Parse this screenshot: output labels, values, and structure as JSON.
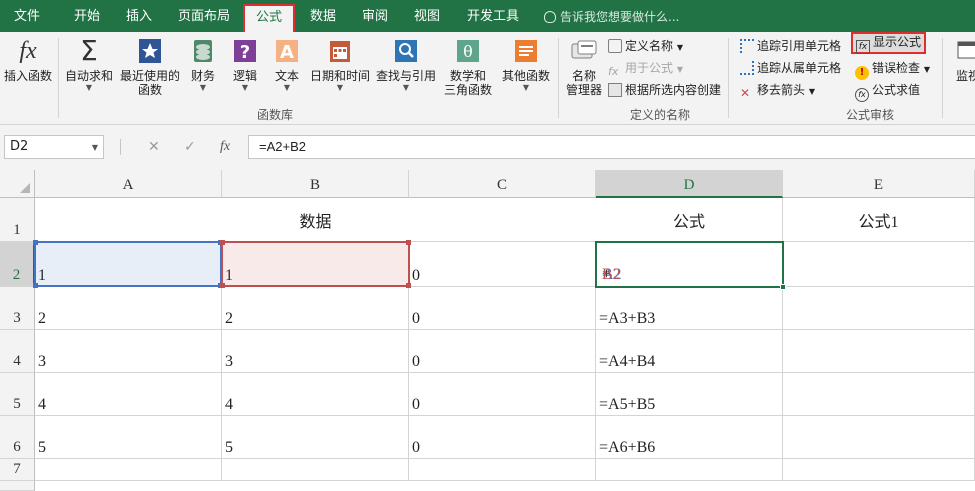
{
  "tabs": [
    {
      "label": "文件"
    },
    {
      "label": "开始"
    },
    {
      "label": "插入"
    },
    {
      "label": "页面布局"
    },
    {
      "label": "公式"
    },
    {
      "label": "数据"
    },
    {
      "label": "审阅"
    },
    {
      "label": "视图"
    },
    {
      "label": "开发工具"
    }
  ],
  "active_tab": "公式",
  "tell_me": "告诉我您想要做什么...",
  "ribbon": {
    "insert_function": "插入函数",
    "autosum": "自动求和",
    "recent": "最近使用的",
    "recent2": "函数",
    "financial": "财务",
    "logical": "逻辑",
    "text": "文本",
    "datetime": "日期和时间",
    "lookup": "查找与引用",
    "math": "数学和",
    "math2": "三角函数",
    "more": "其他函数",
    "group_library": "函数库",
    "name_manager": "名称",
    "name_manager2": "管理器",
    "define_name": "定义名称",
    "use_in_formula": "用于公式",
    "create_from_selection": "根据所选内容创建",
    "group_names": "定义的名称",
    "trace_precedents": "追踪引用单元格",
    "trace_dependents": "追踪从属单元格",
    "remove_arrows": "移去箭头",
    "show_formulas": "显示公式",
    "error_checking": "错误检查",
    "evaluate_formula": "公式求值",
    "group_auditing": "公式审核",
    "watch": "监视"
  },
  "formula_bar": {
    "name_box": "D2",
    "fx": "fx",
    "content": "=A2+B2"
  },
  "columns": [
    "A",
    "B",
    "C",
    "D",
    "E"
  ],
  "rows": [
    "1",
    "2",
    "3",
    "4",
    "5",
    "6",
    "7"
  ],
  "cells": {
    "B1": "数据",
    "D1": "公式",
    "E1": "公式1",
    "A2": "1",
    "B2": "1",
    "C2": "0",
    "A3": "2",
    "B3": "2",
    "C3": "0",
    "D3": "=A3+B3",
    "A4": "3",
    "B4": "3",
    "C4": "0",
    "D4": "=A4+B4",
    "A5": "4",
    "B5": "4",
    "C5": "0",
    "D5": "=A5+B5",
    "A6": "5",
    "B6": "5",
    "C6": "0",
    "D6": "=A6+B6"
  },
  "d2_formula": {
    "eq": "=",
    "ref_a": "A2",
    "plus": "+",
    "ref_b": "B2"
  },
  "colors": {
    "accent": "#217346",
    "highlight": "#e02d2d",
    "ref_a": "#4472c4",
    "ref_b": "#c0504d"
  }
}
